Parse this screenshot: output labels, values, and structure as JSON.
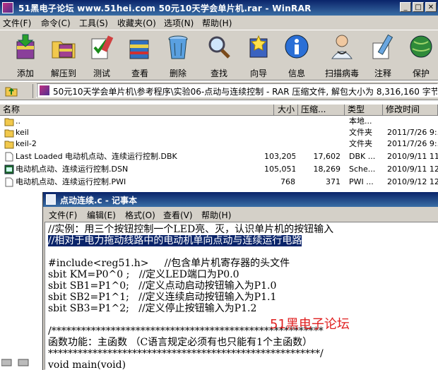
{
  "winrar": {
    "title": "51黑电子论坛 www.51hei.com 50元10天学会单片机.rar - WinRAR",
    "menu": [
      "文件(F)",
      "命令(C)",
      "工具(S)",
      "收藏夹(O)",
      "选项(N)",
      "帮助(H)"
    ],
    "toolbar": [
      "添加",
      "解压到",
      "测试",
      "查看",
      "删除",
      "查找",
      "向导",
      "信息",
      "扫描病毒",
      "注释",
      "保护"
    ],
    "address": "50元10天学会单片机\\参考程序\\实验06-点动与连续控制 - RAR 压缩文件, 解包大小为 8,316,160 字节",
    "columns": [
      "名称",
      "大小",
      "压缩...",
      "类型",
      "修改时间"
    ],
    "files": [
      {
        "name": "..",
        "size": "",
        "packed": "",
        "type": "本地...",
        "modified": ""
      },
      {
        "name": "keil",
        "size": "",
        "packed": "",
        "type": "文件夹",
        "modified": "2011/7/26 9:..."
      },
      {
        "name": "keil-2",
        "size": "",
        "packed": "",
        "type": "文件夹",
        "modified": "2011/7/26 9:..."
      },
      {
        "name": "Last Loaded 电动机点动、连续运行控制.DBK",
        "size": "103,205",
        "packed": "17,602",
        "type": "DBK ...",
        "modified": "2010/9/11 11:..."
      },
      {
        "name": "电动机点动、连续运行控制.DSN",
        "size": "105,051",
        "packed": "18,269",
        "type": "Sche...",
        "modified": "2010/9/11 12:..."
      },
      {
        "name": "电动机点动、连续运行控制.PWI",
        "size": "768",
        "packed": "371",
        "type": "PWI ...",
        "modified": "2010/9/12 12:..."
      }
    ]
  },
  "notepad": {
    "title": "点动连续.c - 记事本",
    "menu": [
      "文件(F)",
      "编辑(E)",
      "格式(O)",
      "查看(V)",
      "帮助(H)"
    ],
    "lines": [
      "//实例：用三个按钮控制一个LED亮、灭，认识单片机的按钮输入",
      "//相对于电力拖动线路中的电动机单向点动与连续运行电路",
      "",
      "#include<reg51.h>     //包含单片机寄存器的头文件",
      "sbit KM=P0^0 ;   //定义LED端口为P0.0",
      "sbit SB1=P1^0;   //定义点动启动按钮输入为P1.0",
      "sbit SB2=P1^1;   //定义连续启动按钮输入为P1.1",
      "sbit SB3=P1^2;   //定义停止按钮输入为P1.2",
      "",
      "/*******************************************************",
      "函数功能：主函数 （C语言规定必须有也只能有1个主函数）",
      "*******************************************************/",
      "void main(void)"
    ],
    "watermark": "51黑电子论坛"
  }
}
